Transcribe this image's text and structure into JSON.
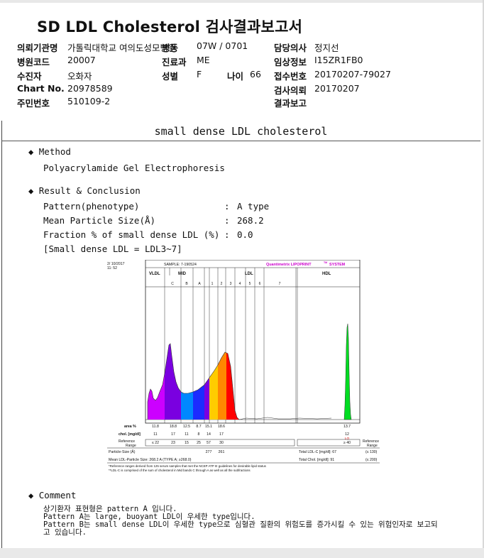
{
  "report": {
    "title": "SD LDL Cholesterol 검사결과보고서"
  },
  "header": {
    "fields": [
      {
        "label": "의뢰기관명",
        "value": "가톨릭대학교 여의도성모병원"
      },
      {
        "label": "병원코드",
        "value": "20007"
      },
      {
        "label": "수진자",
        "value": "오화자"
      },
      {
        "label": "Chart No.",
        "value": "20978589"
      },
      {
        "label": "주민번호",
        "value": "510109-2"
      },
      {
        "label": "병동",
        "value": "07W / 0701"
      },
      {
        "label": "진료과",
        "value": "ME"
      },
      {
        "label": "성별",
        "value": "F"
      },
      {
        "label": "나이",
        "value": "66"
      },
      {
        "label": "담당의사",
        "value": "정지선"
      },
      {
        "label": "임상정보",
        "value": "I15ZR1FB0"
      },
      {
        "label": "접수번호",
        "value": "20170207-79027"
      },
      {
        "label": "검사의뢰",
        "value": "20170207"
      },
      {
        "label": "결과보고",
        "value": ""
      }
    ]
  },
  "section": {
    "title": "small dense LDL cholesterol",
    "method_heading": "Method",
    "method_text": "Polyacrylamide Gel Electrophoresis",
    "result_heading": "Result & Conclusion",
    "results": [
      {
        "label": "Pattern(phenotype)",
        "sep": ":",
        "value": "A type"
      },
      {
        "label": "Mean Particle Size(Å)",
        "sep": ":",
        "value": "268.2"
      },
      {
        "label": "Fraction % of small dense LDL (%)",
        "sep": ":",
        "value": "0.0"
      }
    ],
    "note": "[Small dense LDL = LDL3~7]",
    "comment_heading": "Comment",
    "comment_lines": [
      "상기환자 표현형은 pattern A 입니다.",
      "Pattern A는 large, buoyant LDL이 우세한 type입니다.",
      "Pattern B는 small dense LDL이 우세한 type으로 심혈관 질환의 위험도를 증가시킬 수 있는 위험인자로 보고되",
      "고 있습니다."
    ]
  },
  "chart_data": {
    "type": "area",
    "header": {
      "date": "2/ 10/2017",
      "time": "11: 52",
      "sample": "SAMPLE:  7-190524",
      "brand": "Quantimetrix LIPOPRINT",
      "brand_tm": "TM",
      "brand_suffix": "SYSTEM"
    },
    "groups": [
      "VLDL",
      "MID",
      "LDL",
      "HDL"
    ],
    "bands": [
      "C",
      "B",
      "A",
      "1",
      "2",
      "3",
      "4",
      "5",
      "6",
      "7"
    ],
    "row_labels": {
      "area": "area %",
      "chol": "chol. [mg/dl]",
      "ref": "Reference Range",
      "ref_right": "Reference Range"
    },
    "area_pct": [
      "11.8",
      "18.8",
      "12.5",
      "8.7",
      "15.1",
      "18.6",
      "13.7"
    ],
    "chol": [
      "11",
      "17",
      "11",
      "8",
      "14",
      "17",
      "12"
    ],
    "chol_flag": "LO",
    "reference": [
      "≤ 22",
      "23",
      "15",
      "25",
      "57",
      "30",
      "≥ 40"
    ],
    "particle_size_label": "Particle-Size (Å)",
    "particle_sizes": [
      "277",
      "261"
    ],
    "mean_ldl_label": "Mean LDL-Particle Size:  268.2 A  (TYPE A; ≥268.0)",
    "total_ldl": "Total LDL-C [mg/dl]:  67",
    "total_ldl_ref": "(≤ 130)",
    "total_chol": "Total Chol. [mg/dl]:  91",
    "total_chol_ref": "(≤ 200)",
    "footnotes": [
      "*Reference ranges derived from 125 serum samples that met the NCEP ATP III guidelines for desirable lipid status",
      "**LDL-C is comprised of the sum of cholesterol in Mid bands C through A as well as all the subfractions"
    ]
  }
}
